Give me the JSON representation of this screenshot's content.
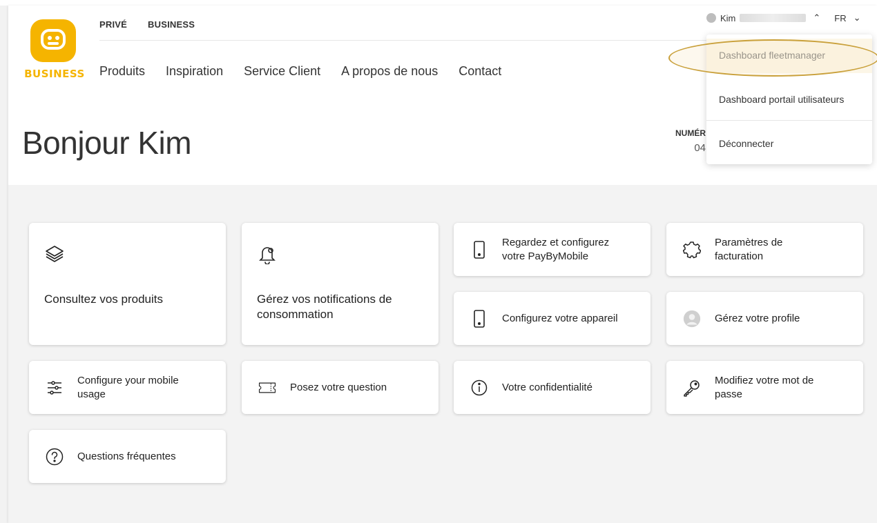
{
  "header": {
    "logo_text": "BUSINESS",
    "segments": [
      "PRIVÉ",
      "BUSINESS"
    ],
    "main_nav": [
      "Produits",
      "Inspiration",
      "Service Client",
      "A propos de nous",
      "Contact"
    ],
    "user": {
      "name": "Kim",
      "language": "FR"
    },
    "account_number_label": "NUMÉR",
    "account_number_value": "04"
  },
  "page": {
    "title": "Bonjour Kim"
  },
  "dropdown": {
    "items": [
      "Dashboard fleetmanager",
      "Dashboard portail utilisateurs",
      "Déconnecter"
    ]
  },
  "cards": {
    "products": "Consultez vos produits",
    "notifications": "Gérez vos notifications de consommation",
    "paybymobile": "Regardez et configurez votre PayByMobile",
    "billing": "Paramètres de facturation",
    "device": "Configurez votre appareil",
    "profile": "Gérez votre profile",
    "mobile_usage": "Configure your mobile usage",
    "question": "Posez votre question",
    "privacy": "Votre confidentialité",
    "password": "Modifiez votre mot de passe",
    "faq": "Questions fréquentes"
  },
  "colors": {
    "brand": "#f5b400",
    "annotation": "#c9a03a"
  }
}
